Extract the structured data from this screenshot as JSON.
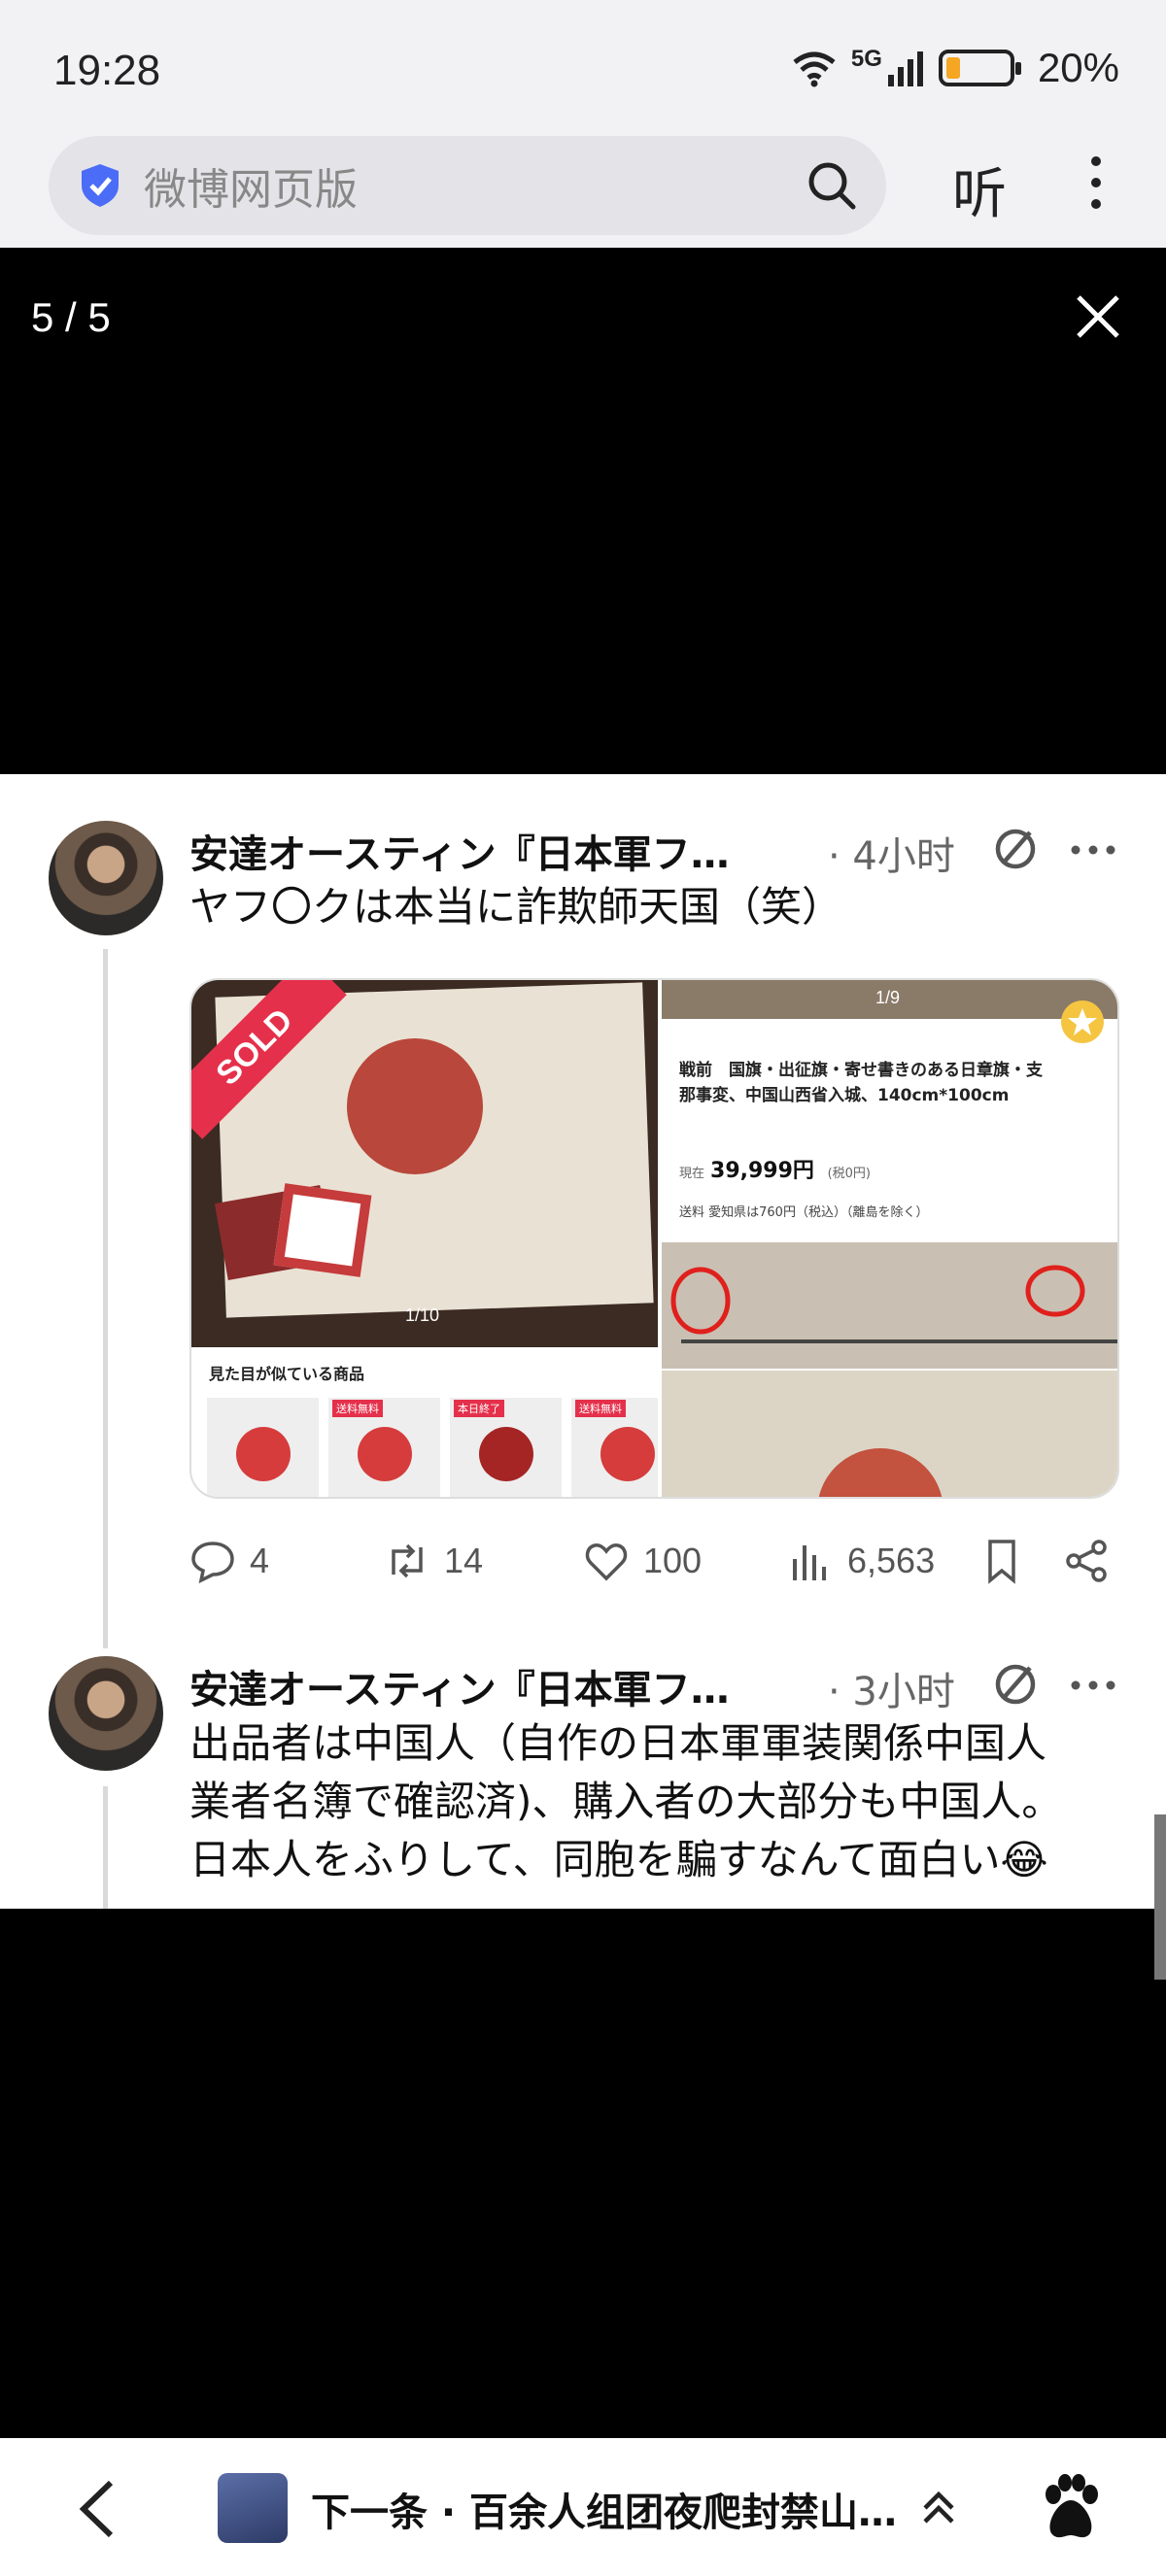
{
  "status_bar": {
    "time": "19:28",
    "network": "5G",
    "battery": "20%",
    "battery_level": 0.2
  },
  "browser": {
    "search_placeholder": "微博网页版",
    "listen_label": "听"
  },
  "viewer": {
    "counter": "5 / 5"
  },
  "tweets": [
    {
      "author": "安達オースティン『日本軍フ…",
      "time": "· 4小时",
      "text": "ヤフ〇クは本当に詐欺師天国（笑）",
      "media": {
        "sold_badge": "SOLD",
        "left_pager": "1/10",
        "right_pager": "1/9",
        "similar_label": "見た目が似ている商品",
        "thumb_tags": [
          "送料無料",
          "本日終了",
          "送料無料"
        ],
        "listing_title": "戦前　国旗・出征旗・寄せ書きのある日章旗・支那事変、中国山西省入城、140cm*100cm",
        "listing_price_label": "現在",
        "listing_price": "39,999円",
        "listing_price_tax": "(税0円)",
        "listing_shipping": "送料 愛知県は760円（税込）（離島を除く）"
      },
      "replies": "4",
      "retweets": "14",
      "likes": "100",
      "views": "6,563"
    },
    {
      "author": "安達オースティン『日本軍フ…",
      "time": "· 3小时",
      "text_lines": [
        "出品者は中国人（自作の日本軍軍装関係中国人",
        "業者名簿で確認済)、購入者の大部分も中国人。",
        "日本人をふりして、同胞を騙すなんて面白い😂"
      ]
    }
  ],
  "bottom_bar": {
    "next_label": "下一条 · 百余人组团夜爬封禁山…"
  },
  "colors": {
    "background": "#000000",
    "card": "#ffffff",
    "sold_badge": "#e5304b",
    "flag_sun": "#b9473b",
    "battery_fill": "#f5a623",
    "shield": "#4a6cf7"
  }
}
